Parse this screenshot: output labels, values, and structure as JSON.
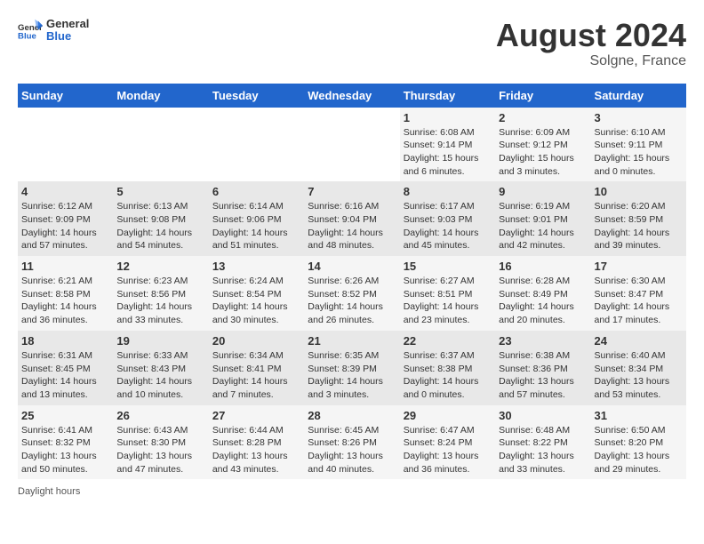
{
  "header": {
    "logo": {
      "general": "General",
      "blue": "Blue"
    },
    "month_year": "August 2024",
    "location": "Solgne, France"
  },
  "days_of_week": [
    "Sunday",
    "Monday",
    "Tuesday",
    "Wednesday",
    "Thursday",
    "Friday",
    "Saturday"
  ],
  "weeks": [
    [
      {
        "day": "",
        "info": ""
      },
      {
        "day": "",
        "info": ""
      },
      {
        "day": "",
        "info": ""
      },
      {
        "day": "",
        "info": ""
      },
      {
        "day": "1",
        "info": "Sunrise: 6:08 AM\nSunset: 9:14 PM\nDaylight: 15 hours\nand 6 minutes."
      },
      {
        "day": "2",
        "info": "Sunrise: 6:09 AM\nSunset: 9:12 PM\nDaylight: 15 hours\nand 3 minutes."
      },
      {
        "day": "3",
        "info": "Sunrise: 6:10 AM\nSunset: 9:11 PM\nDaylight: 15 hours\nand 0 minutes."
      }
    ],
    [
      {
        "day": "4",
        "info": "Sunrise: 6:12 AM\nSunset: 9:09 PM\nDaylight: 14 hours\nand 57 minutes."
      },
      {
        "day": "5",
        "info": "Sunrise: 6:13 AM\nSunset: 9:08 PM\nDaylight: 14 hours\nand 54 minutes."
      },
      {
        "day": "6",
        "info": "Sunrise: 6:14 AM\nSunset: 9:06 PM\nDaylight: 14 hours\nand 51 minutes."
      },
      {
        "day": "7",
        "info": "Sunrise: 6:16 AM\nSunset: 9:04 PM\nDaylight: 14 hours\nand 48 minutes."
      },
      {
        "day": "8",
        "info": "Sunrise: 6:17 AM\nSunset: 9:03 PM\nDaylight: 14 hours\nand 45 minutes."
      },
      {
        "day": "9",
        "info": "Sunrise: 6:19 AM\nSunset: 9:01 PM\nDaylight: 14 hours\nand 42 minutes."
      },
      {
        "day": "10",
        "info": "Sunrise: 6:20 AM\nSunset: 8:59 PM\nDaylight: 14 hours\nand 39 minutes."
      }
    ],
    [
      {
        "day": "11",
        "info": "Sunrise: 6:21 AM\nSunset: 8:58 PM\nDaylight: 14 hours\nand 36 minutes."
      },
      {
        "day": "12",
        "info": "Sunrise: 6:23 AM\nSunset: 8:56 PM\nDaylight: 14 hours\nand 33 minutes."
      },
      {
        "day": "13",
        "info": "Sunrise: 6:24 AM\nSunset: 8:54 PM\nDaylight: 14 hours\nand 30 minutes."
      },
      {
        "day": "14",
        "info": "Sunrise: 6:26 AM\nSunset: 8:52 PM\nDaylight: 14 hours\nand 26 minutes."
      },
      {
        "day": "15",
        "info": "Sunrise: 6:27 AM\nSunset: 8:51 PM\nDaylight: 14 hours\nand 23 minutes."
      },
      {
        "day": "16",
        "info": "Sunrise: 6:28 AM\nSunset: 8:49 PM\nDaylight: 14 hours\nand 20 minutes."
      },
      {
        "day": "17",
        "info": "Sunrise: 6:30 AM\nSunset: 8:47 PM\nDaylight: 14 hours\nand 17 minutes."
      }
    ],
    [
      {
        "day": "18",
        "info": "Sunrise: 6:31 AM\nSunset: 8:45 PM\nDaylight: 14 hours\nand 13 minutes."
      },
      {
        "day": "19",
        "info": "Sunrise: 6:33 AM\nSunset: 8:43 PM\nDaylight: 14 hours\nand 10 minutes."
      },
      {
        "day": "20",
        "info": "Sunrise: 6:34 AM\nSunset: 8:41 PM\nDaylight: 14 hours\nand 7 minutes."
      },
      {
        "day": "21",
        "info": "Sunrise: 6:35 AM\nSunset: 8:39 PM\nDaylight: 14 hours\nand 3 minutes."
      },
      {
        "day": "22",
        "info": "Sunrise: 6:37 AM\nSunset: 8:38 PM\nDaylight: 14 hours\nand 0 minutes."
      },
      {
        "day": "23",
        "info": "Sunrise: 6:38 AM\nSunset: 8:36 PM\nDaylight: 13 hours\nand 57 minutes."
      },
      {
        "day": "24",
        "info": "Sunrise: 6:40 AM\nSunset: 8:34 PM\nDaylight: 13 hours\nand 53 minutes."
      }
    ],
    [
      {
        "day": "25",
        "info": "Sunrise: 6:41 AM\nSunset: 8:32 PM\nDaylight: 13 hours\nand 50 minutes."
      },
      {
        "day": "26",
        "info": "Sunrise: 6:43 AM\nSunset: 8:30 PM\nDaylight: 13 hours\nand 47 minutes."
      },
      {
        "day": "27",
        "info": "Sunrise: 6:44 AM\nSunset: 8:28 PM\nDaylight: 13 hours\nand 43 minutes."
      },
      {
        "day": "28",
        "info": "Sunrise: 6:45 AM\nSunset: 8:26 PM\nDaylight: 13 hours\nand 40 minutes."
      },
      {
        "day": "29",
        "info": "Sunrise: 6:47 AM\nSunset: 8:24 PM\nDaylight: 13 hours\nand 36 minutes."
      },
      {
        "day": "30",
        "info": "Sunrise: 6:48 AM\nSunset: 8:22 PM\nDaylight: 13 hours\nand 33 minutes."
      },
      {
        "day": "31",
        "info": "Sunrise: 6:50 AM\nSunset: 8:20 PM\nDaylight: 13 hours\nand 29 minutes."
      }
    ]
  ],
  "footer": {
    "label": "Daylight hours"
  }
}
